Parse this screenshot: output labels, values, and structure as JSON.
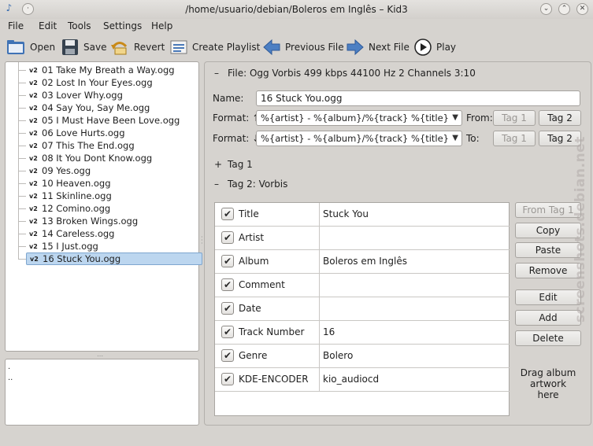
{
  "window": {
    "title": "/home/usuario/debian/Boleros em Inglês – Kid3"
  },
  "menu": [
    "File",
    "Edit",
    "Tools",
    "Settings",
    "Help"
  ],
  "toolbar": {
    "open": "Open",
    "save": "Save",
    "revert": "Revert",
    "create_playlist": "Create Playlist",
    "previous_file": "Previous File",
    "next_file": "Next File",
    "play": "Play"
  },
  "files": [
    {
      "tag": "v2",
      "name": "01 Take My Breath a Way.ogg"
    },
    {
      "tag": "v2",
      "name": "02 Lost In Your Eyes.ogg"
    },
    {
      "tag": "v2",
      "name": "03 Lover Why.ogg"
    },
    {
      "tag": "v2",
      "name": "04 Say You, Say Me.ogg"
    },
    {
      "tag": "v2",
      "name": "05 I Must Have Been Love.ogg"
    },
    {
      "tag": "v2",
      "name": "06 Love Hurts.ogg"
    },
    {
      "tag": "v2",
      "name": "07 This The End.ogg"
    },
    {
      "tag": "v2",
      "name": "08 It You Dont Know.ogg"
    },
    {
      "tag": "v2",
      "name": "09 Yes.ogg"
    },
    {
      "tag": "v2",
      "name": "10 Heaven.ogg"
    },
    {
      "tag": "v2",
      "name": "11 Skinline.ogg"
    },
    {
      "tag": "v2",
      "name": "12 Comino.ogg"
    },
    {
      "tag": "v2",
      "name": "13 Broken Wings.ogg"
    },
    {
      "tag": "v2",
      "name": "14 Careless.ogg"
    },
    {
      "tag": "v2",
      "name": "15 I Just.ogg"
    },
    {
      "tag": "v2",
      "name": "16 Stuck You.ogg"
    }
  ],
  "dirs": [
    ".",
    ".."
  ],
  "file_section": {
    "expander": "–",
    "header": "File: Ogg Vorbis 499 kbps 44100 Hz 2 Channels 3:10",
    "name_label": "Name:",
    "name_value": "16 Stuck You.ogg",
    "format_up_label": "Format: ↑",
    "format_up_value": "%{artist} - %{album}/%{track} %{title}",
    "from_label": "From:",
    "format_down_label": "Format: ↓",
    "format_down_value": "%{artist} - %{album}/%{track} %{title}",
    "to_label": "To:",
    "tag1_button": "Tag 1",
    "tag2_button": "Tag 2"
  },
  "tag1_section": {
    "expander": "+",
    "header": "Tag 1"
  },
  "tag2_section": {
    "expander": "–",
    "header": "Tag 2: Vorbis"
  },
  "frames": [
    {
      "name": "Title",
      "value": "Stuck You"
    },
    {
      "name": "Artist",
      "value": ""
    },
    {
      "name": "Album",
      "value": "Boleros em Inglês"
    },
    {
      "name": "Comment",
      "value": ""
    },
    {
      "name": "Date",
      "value": ""
    },
    {
      "name": "Track Number",
      "value": "16"
    },
    {
      "name": "Genre",
      "value": "Bolero"
    },
    {
      "name": "KDE-ENCODER",
      "value": "kio_audiocd"
    }
  ],
  "side_buttons": {
    "from_tag1": "From Tag 1",
    "copy": "Copy",
    "paste": "Paste",
    "remove": "Remove",
    "edit": "Edit",
    "add": "Add",
    "delete": "Delete"
  },
  "artwork_hint": "Drag album artwork here",
  "watermark": "screenshots.debian.net",
  "colors": {
    "selection": "#bcd6ef",
    "window_bg": "#d6d3cf"
  }
}
